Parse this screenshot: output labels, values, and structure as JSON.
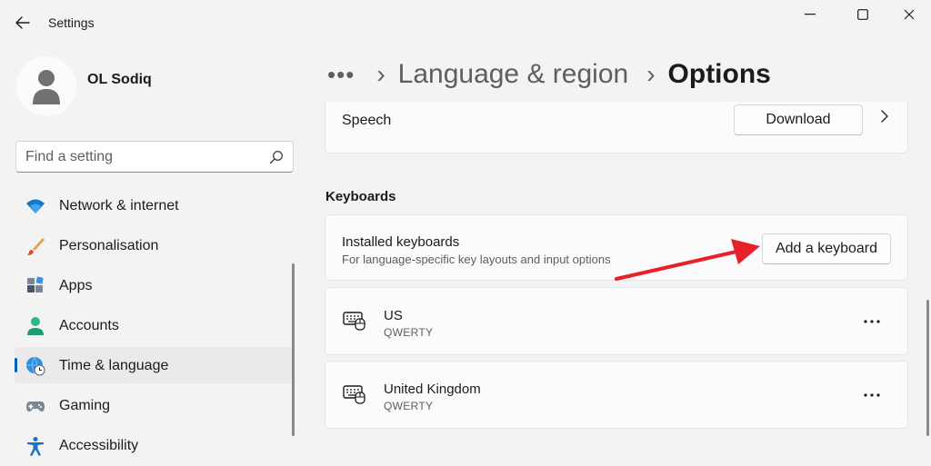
{
  "window": {
    "title": "Settings"
  },
  "profile": {
    "name": "OL Sodiq"
  },
  "search": {
    "placeholder": "Find a setting"
  },
  "sidebar": {
    "items": [
      {
        "label": "Network & internet",
        "icon": "wifi-icon",
        "active": false
      },
      {
        "label": "Personalisation",
        "icon": "brush-icon",
        "active": false
      },
      {
        "label": "Apps",
        "icon": "apps-icon",
        "active": false
      },
      {
        "label": "Accounts",
        "icon": "person-icon",
        "active": false
      },
      {
        "label": "Time & language",
        "icon": "globe-clock-icon",
        "active": true
      },
      {
        "label": "Gaming",
        "icon": "gamepad-icon",
        "active": false
      },
      {
        "label": "Accessibility",
        "icon": "accessibility-icon",
        "active": false
      }
    ]
  },
  "breadcrumb": {
    "more": "•••",
    "parent": "Language & region",
    "current": "Options"
  },
  "speech": {
    "label": "Speech",
    "download_label": "Download"
  },
  "keyboards": {
    "section_title": "Keyboards",
    "installed_title": "Installed keyboards",
    "installed_subtitle": "For language-specific key layouts and input options",
    "add_label": "Add a keyboard",
    "items": [
      {
        "name": "US",
        "layout": "QWERTY"
      },
      {
        "name": "United Kingdom",
        "layout": "QWERTY"
      }
    ]
  },
  "colors": {
    "accent": "#005fb8",
    "annotation_arrow": "#e8202a",
    "background": "#f3f3f3",
    "card": "#fbfbfb"
  }
}
